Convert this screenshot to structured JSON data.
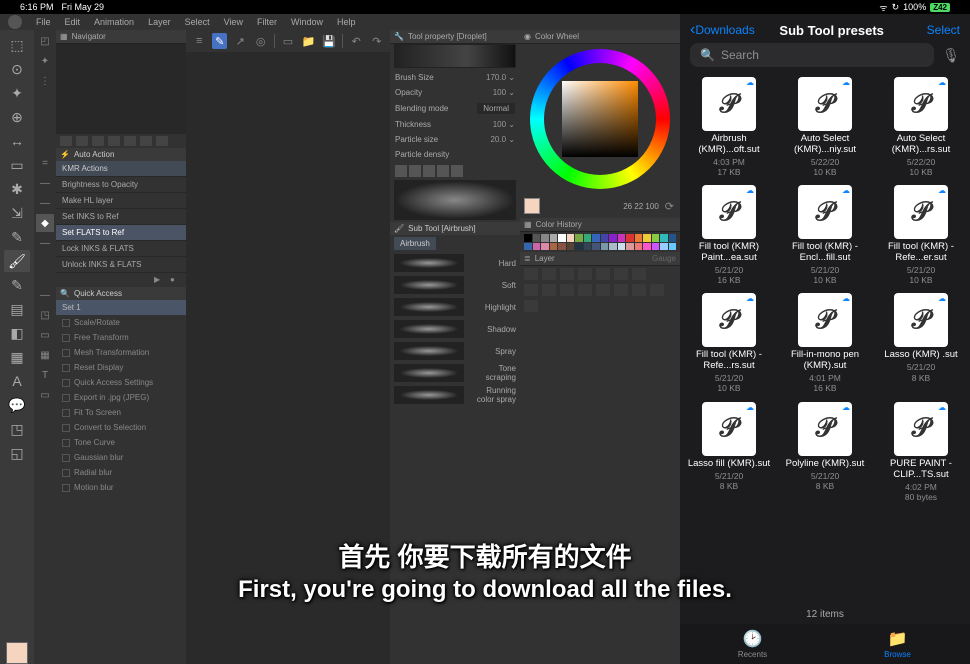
{
  "status": {
    "time": "6:16 PM",
    "date": "Fri May 29",
    "battery": "100%",
    "battery_badge": "Z42"
  },
  "menu": {
    "items": [
      "File",
      "Edit",
      "Animation",
      "Layer",
      "Select",
      "View",
      "Filter",
      "Window",
      "Help"
    ]
  },
  "tools_left": [
    "⬚",
    "⊙",
    "✦",
    "⊕",
    "↔",
    "▭",
    "✱",
    "⇲",
    "✎",
    "🖌",
    "✎",
    "▤",
    "◧",
    "▦",
    "A",
    "💬",
    "◳",
    "◱"
  ],
  "tools_aux": [
    "◰",
    "✦",
    "⋮",
    "=",
    "—",
    "—",
    "◆",
    "—",
    "—",
    "◳",
    "▭",
    "▦",
    "T",
    "▭",
    "◰"
  ],
  "navigator": {
    "title": "Navigator"
  },
  "auto_action": {
    "title": "Auto Action",
    "group": "KMR Actions",
    "items": [
      "Brightness to Opacity",
      "Make HL layer",
      "Set INKS to Ref",
      "Set FLATS to Ref",
      "Lock INKS & FLATS",
      "Unlock INKS & FLATS"
    ],
    "selected_index": 3
  },
  "quick_access": {
    "title": "Quick Access",
    "set_label": "Set 1",
    "items": [
      "Scale/Rotate",
      "Free Transform",
      "Mesh Transformation",
      "Reset Display",
      "Quick Access Settings",
      "Export in .jpg (JPEG)",
      "Fit To Screen",
      "Convert to Selection",
      "Tone Curve",
      "Gaussian blur",
      "Radial blur",
      "Motion blur"
    ]
  },
  "tool_property": {
    "title": "Tool property [Droplet]",
    "rows": {
      "brush_size_label": "Brush Size",
      "brush_size_val": "170.0",
      "opacity_label": "Opacity",
      "opacity_val": "100",
      "blending_label": "Blending mode",
      "blending_val": "Normal",
      "thickness_label": "Thickness",
      "thickness_val": "100",
      "particle_size_label": "Particle size",
      "particle_size_val": "20.0",
      "particle_density_label": "Particle density"
    }
  },
  "subtool": {
    "title": "Sub Tool [Airbrush]",
    "tab": "Airbrush",
    "brushes": [
      "Hard",
      "Soft",
      "Highlight",
      "Shadow",
      "Spray",
      "Tone scraping",
      "Running color spray"
    ]
  },
  "color_wheel": {
    "title": "Color Wheel",
    "readout": "26   22   100"
  },
  "color_history": {
    "title": "Color History"
  },
  "layer": {
    "title": "Layer",
    "nav": "Gauge"
  },
  "files": {
    "back": "Downloads",
    "title": "Sub Tool presets",
    "select": "Select",
    "search_placeholder": "Search",
    "count": "12 items",
    "tabs": {
      "recents": "Recents",
      "browse": "Browse"
    },
    "items": [
      {
        "name": "Airbrush (KMR)...oft.sut",
        "date": "4:03 PM",
        "size": "17 KB"
      },
      {
        "name": "Auto Select (KMR)...niy.sut",
        "date": "5/22/20",
        "size": "10 KB"
      },
      {
        "name": "Auto Select (KMR)...rs.sut",
        "date": "5/22/20",
        "size": "10 KB"
      },
      {
        "name": "Fill tool (KMR) Paint...ea.sut",
        "date": "5/21/20",
        "size": "16 KB"
      },
      {
        "name": "Fill tool (KMR) - Encl...fill.sut",
        "date": "5/21/20",
        "size": "10 KB"
      },
      {
        "name": "Fill tool (KMR) - Refe...er.sut",
        "date": "5/21/20",
        "size": "10 KB"
      },
      {
        "name": "Fill tool (KMR) - Refe...rs.sut",
        "date": "5/21/20",
        "size": "10 KB"
      },
      {
        "name": "Fill-in-mono pen (KMR).sut",
        "date": "4:01 PM",
        "size": "16 KB"
      },
      {
        "name": "Lasso (KMR) .sut",
        "date": "5/21/20",
        "size": "8 KB"
      },
      {
        "name": "Lasso fill (KMR).sut",
        "date": "5/21/20",
        "size": "8 KB"
      },
      {
        "name": "Polyline (KMR).sut",
        "date": "5/21/20",
        "size": "8 KB"
      },
      {
        "name": "PURE PAINT - CLIP...TS.sut",
        "date": "4:02 PM",
        "size": "80 bytes"
      }
    ]
  },
  "swatch_colors": [
    "#000",
    "#555",
    "#888",
    "#aaa",
    "#fff",
    "#f5d5c0",
    "#7a4",
    "#3a7",
    "#36b",
    "#44a",
    "#82c",
    "#c3b",
    "#d33",
    "#e73",
    "#ec3",
    "#8c4",
    "#3bb",
    "#258",
    "#36a",
    "#c6a",
    "#d8a",
    "#a64",
    "#854",
    "#543",
    "#234",
    "#345",
    "#457",
    "#79a",
    "#abc",
    "#cde",
    "#d99",
    "#e77",
    "#f5c",
    "#c5f",
    "#9cf",
    "#6cf"
  ],
  "subtitles": {
    "cn": "首先 你要下载所有的文件",
    "en": "First, you're going to download all the files."
  }
}
